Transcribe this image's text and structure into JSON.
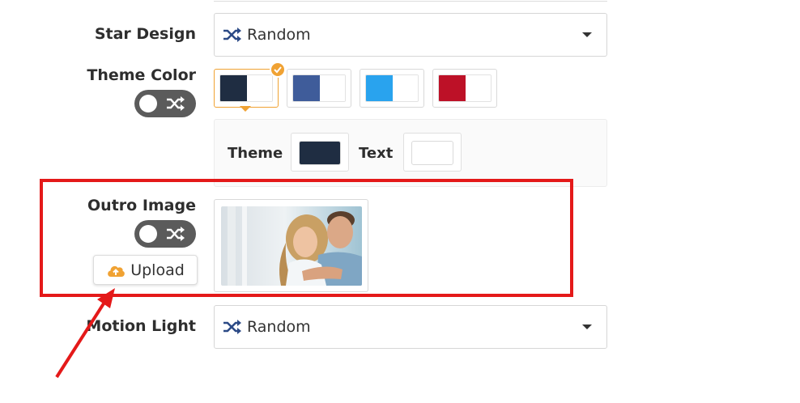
{
  "star_design": {
    "label": "Star Design",
    "value": "Random",
    "icon": "shuffle-icon"
  },
  "theme_color": {
    "label": "Theme Color",
    "swatches": [
      {
        "primary": "#1f2d42",
        "secondary": "#ffffff",
        "selected": true
      },
      {
        "primary": "#3f5c9a",
        "secondary": "#ffffff",
        "selected": false
      },
      {
        "primary": "#29a3ee",
        "secondary": "#ffffff",
        "selected": false
      },
      {
        "primary": "#bd1127",
        "secondary": "#ffffff",
        "selected": false
      }
    ],
    "theme_label": "Theme",
    "theme_color": "#1f2d42",
    "text_label": "Text",
    "text_color": "#ffffff"
  },
  "outro_image": {
    "label": "Outro Image",
    "upload_label": "Upload",
    "upload_icon": "cloud-upload-icon"
  },
  "motion_light": {
    "label": "Motion Light",
    "value": "Random",
    "icon": "shuffle-icon"
  },
  "colors": {
    "accent": "#f0a233",
    "highlight": "#e41919",
    "toggle": "#5b5b5b",
    "icon_blue": "#2c4a86"
  }
}
